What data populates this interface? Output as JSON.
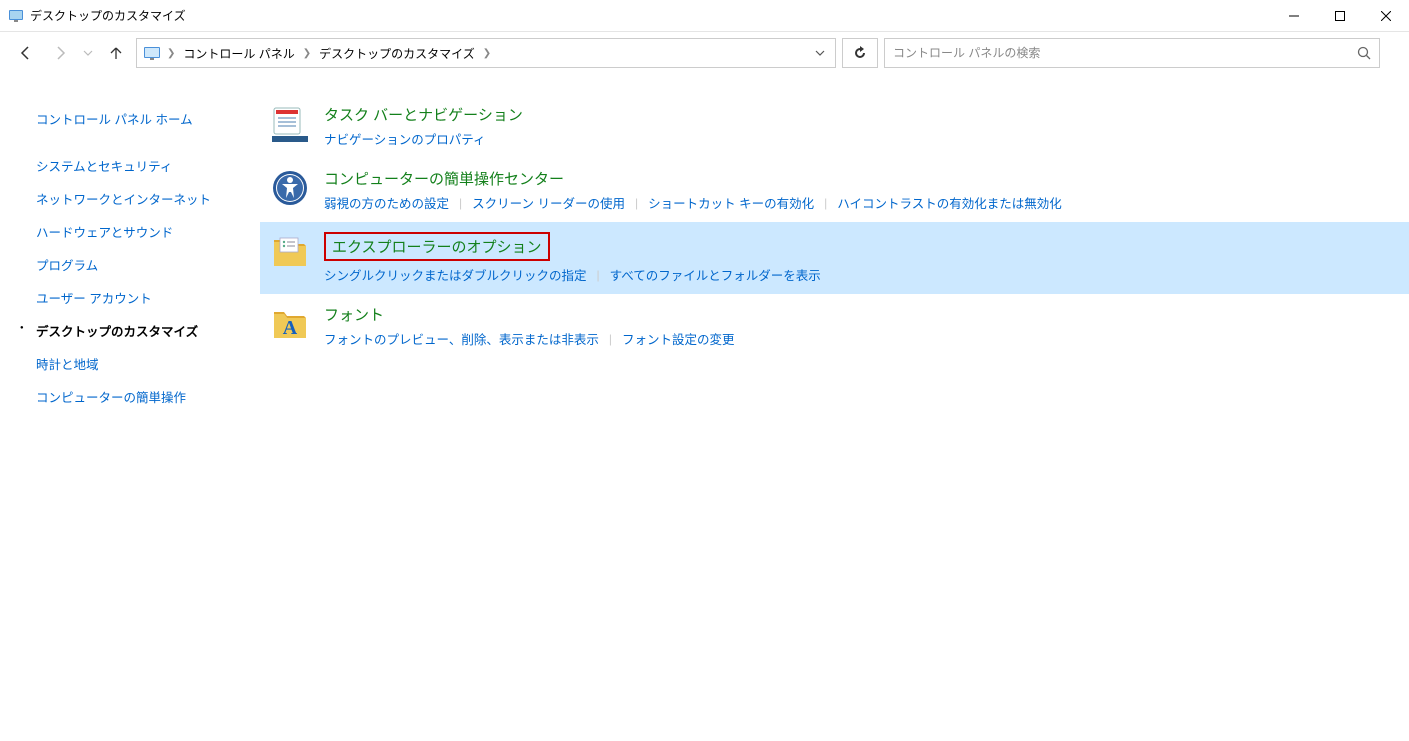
{
  "window": {
    "title": "デスクトップのカスタマイズ"
  },
  "breadcrumb": {
    "seg1": "コントロール パネル",
    "seg2": "デスクトップのカスタマイズ"
  },
  "search": {
    "placeholder": "コントロール パネルの検索"
  },
  "sidebar": {
    "home": "コントロール パネル ホーム",
    "items": [
      "システムとセキュリティ",
      "ネットワークとインターネット",
      "ハードウェアとサウンド",
      "プログラム",
      "ユーザー アカウント",
      "デスクトップのカスタマイズ",
      "時計と地域",
      "コンピューターの簡単操作"
    ],
    "activeIndex": 5
  },
  "categories": [
    {
      "title": "タスク バーとナビゲーション",
      "links": [
        "ナビゲーションのプロパティ"
      ],
      "icon": "taskbar",
      "highlighted": false,
      "boxed": false
    },
    {
      "title": "コンピューターの簡単操作センター",
      "links": [
        "弱視の方のための設定",
        "スクリーン リーダーの使用",
        "ショートカット キーの有効化",
        "ハイコントラストの有効化または無効化"
      ],
      "icon": "ease",
      "highlighted": false,
      "boxed": false
    },
    {
      "title": "エクスプローラーのオプション",
      "links": [
        "シングルクリックまたはダブルクリックの指定",
        "すべてのファイルとフォルダーを表示"
      ],
      "icon": "folder-options",
      "highlighted": true,
      "boxed": true
    },
    {
      "title": "フォント",
      "links": [
        "フォントのプレビュー、削除、表示または非表示",
        "フォント設定の変更"
      ],
      "icon": "font",
      "highlighted": false,
      "boxed": false
    }
  ]
}
